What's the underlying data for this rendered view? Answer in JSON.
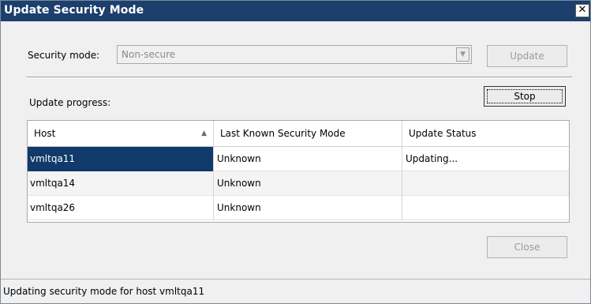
{
  "window": {
    "title": "Update Security Mode",
    "close_glyph": "✕"
  },
  "security": {
    "label": "Security mode:",
    "value": "Non-secure",
    "dropdown_glyph": "▼",
    "update_label": "Update"
  },
  "progress": {
    "label": "Update progress:",
    "stop_label": "Stop"
  },
  "table": {
    "columns": [
      {
        "label": "Host",
        "sort": "ascending"
      },
      {
        "label": "Last Known Security Mode"
      },
      {
        "label": "Update Status"
      }
    ],
    "sort_glyph": "▲",
    "rows": [
      {
        "host": "vmltqa11",
        "mode": "Unknown",
        "status": "Updating...",
        "selected": true
      },
      {
        "host": "vmltqa14",
        "mode": "Unknown",
        "status": ""
      },
      {
        "host": "vmltqa26",
        "mode": "Unknown",
        "status": ""
      }
    ]
  },
  "footer": {
    "close_label": "Close"
  },
  "statusbar": {
    "text": "Updating security mode for host vmltqa11"
  },
  "colors": {
    "titlebar": "#1c3f6e",
    "selection": "#0f3a6b",
    "dialog_bg": "#f0f0f0"
  }
}
